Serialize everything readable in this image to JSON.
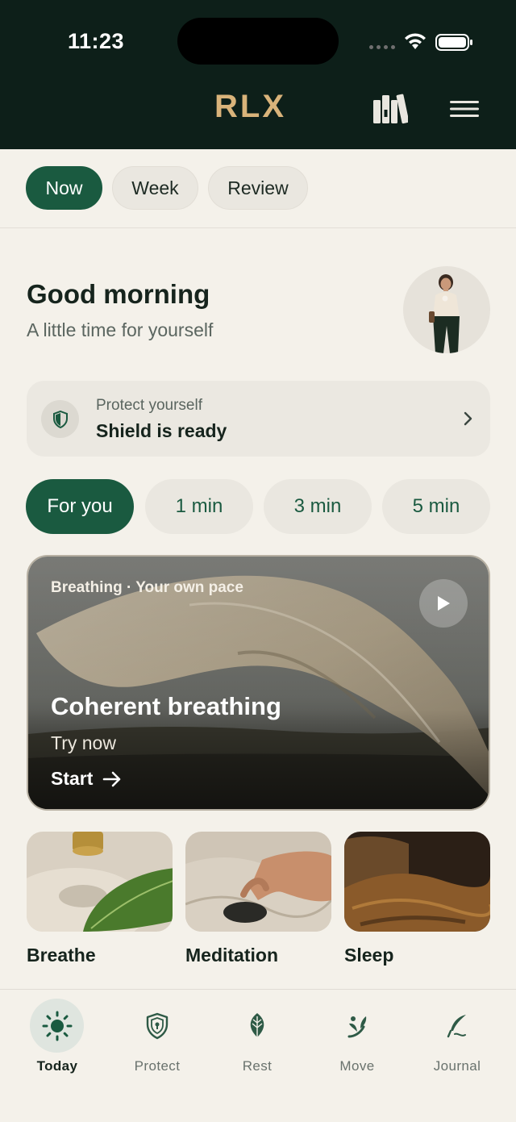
{
  "status_bar": {
    "time": "11:23"
  },
  "header": {
    "logo": "RLX",
    "library_icon": "library-icon",
    "menu_icon": "hamburger-menu-icon"
  },
  "segments": [
    {
      "label": "Now",
      "active": true
    },
    {
      "label": "Week",
      "active": false
    },
    {
      "label": "Review",
      "active": false
    }
  ],
  "greeting": {
    "title": "Good morning",
    "subtitle": "A little time for yourself"
  },
  "protect_card": {
    "label": "Protect yourself",
    "title": "Shield is ready",
    "icon": "shield-icon"
  },
  "duration_chips": [
    {
      "label": "For you",
      "active": true
    },
    {
      "label": "1 min",
      "active": false
    },
    {
      "label": "3 min",
      "active": false
    },
    {
      "label": "5 min",
      "active": false
    }
  ],
  "hero": {
    "kicker": "Breathing · Your own pace",
    "title": "Coherent breathing",
    "subtitle": "Try now",
    "cta": "Start"
  },
  "categories": [
    {
      "label": "Breathe"
    },
    {
      "label": "Meditation"
    },
    {
      "label": "Sleep"
    }
  ],
  "bottom_nav": [
    {
      "label": "Today",
      "icon": "sun-icon",
      "active": true
    },
    {
      "label": "Protect",
      "icon": "shield-icon",
      "active": false
    },
    {
      "label": "Rest",
      "icon": "leaf-icon",
      "active": false
    },
    {
      "label": "Move",
      "icon": "sprout-icon",
      "active": false
    },
    {
      "label": "Journal",
      "icon": "quill-icon",
      "active": false
    }
  ],
  "colors": {
    "header_bg": "#0d1f19",
    "accent": "#1a5a40",
    "logo": "#d9b37a",
    "page_bg": "#f4f1ea"
  }
}
